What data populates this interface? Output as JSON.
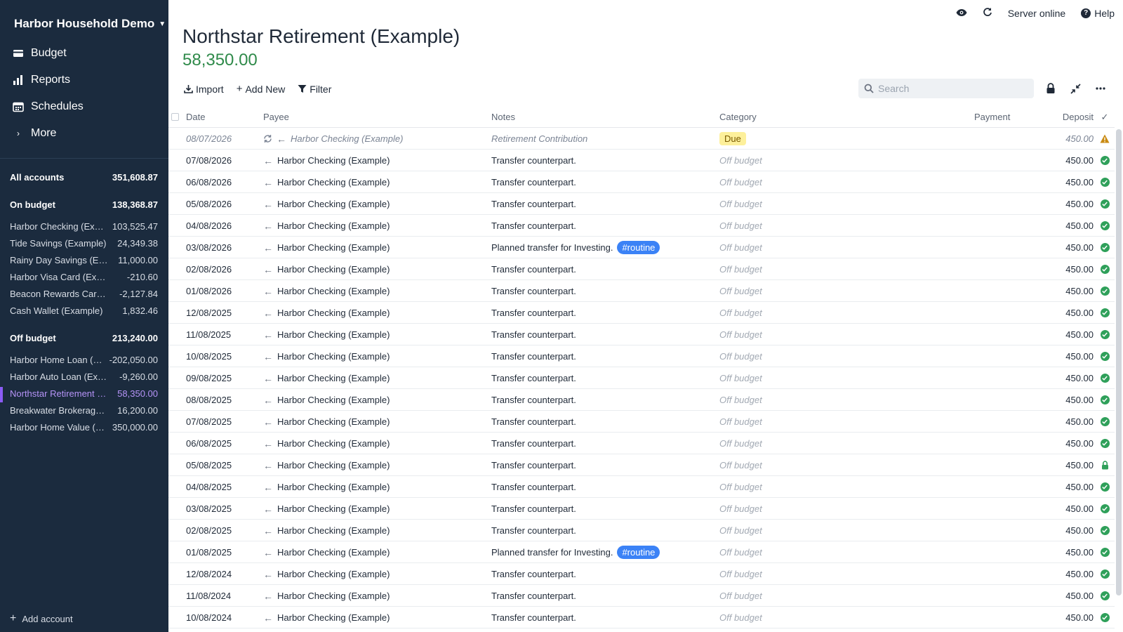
{
  "sidebar": {
    "budget_name": "Harbor Household Demo",
    "nav": [
      {
        "label": "Budget",
        "icon": "budget-icon"
      },
      {
        "label": "Reports",
        "icon": "reports-icon"
      },
      {
        "label": "Schedules",
        "icon": "calendar-icon"
      },
      {
        "label": "More",
        "icon": "chevron-right-icon"
      }
    ],
    "all_accounts": {
      "name": "All accounts",
      "balance": "351,608.87"
    },
    "on_budget": {
      "name": "On budget",
      "balance": "138,368.87"
    },
    "on_budget_accounts": [
      {
        "name": "Harbor Checking (Example)",
        "balance": "103,525.47"
      },
      {
        "name": "Tide Savings (Example)",
        "balance": "24,349.38"
      },
      {
        "name": "Rainy Day Savings (Example)",
        "balance": "11,000.00"
      },
      {
        "name": "Harbor Visa Card (Example)",
        "balance": "-210.60"
      },
      {
        "name": "Beacon Rewards Card (Example)",
        "balance": "-2,127.84"
      },
      {
        "name": "Cash Wallet (Example)",
        "balance": "1,832.46"
      }
    ],
    "off_budget": {
      "name": "Off budget",
      "balance": "213,240.00"
    },
    "off_budget_accounts": [
      {
        "name": "Harbor Home Loan (Example)",
        "balance": "-202,050.00"
      },
      {
        "name": "Harbor Auto Loan (Example)",
        "balance": "-9,260.00"
      },
      {
        "name": "Northstar Retirement (Example)",
        "balance": "58,350.00"
      },
      {
        "name": "Breakwater Brokerage (Example)",
        "balance": "16,200.00"
      },
      {
        "name": "Harbor Home Value (Example)",
        "balance": "350,000.00"
      }
    ],
    "add_account": "Add account"
  },
  "topbar": {
    "server_status": "Server online",
    "help": "Help"
  },
  "account": {
    "title": "Northstar Retirement (Example)",
    "balance": "58,350.00"
  },
  "toolbar": {
    "import": "Import",
    "add_new": "Add New",
    "filter": "Filter",
    "search_placeholder": "Search"
  },
  "table": {
    "headers": {
      "date": "Date",
      "payee": "Payee",
      "notes": "Notes",
      "category": "Category",
      "payment": "Payment",
      "deposit": "Deposit",
      "cleared": "✓"
    },
    "rows": [
      {
        "date": "08/07/2026",
        "payee": "Harbor Checking (Example)",
        "notes": "Retirement Contribution",
        "tag": "",
        "category": "Due",
        "deposit": "450.00",
        "status": "warning",
        "scheduled": true
      },
      {
        "date": "07/08/2026",
        "payee": "Harbor Checking (Example)",
        "notes": "Transfer counterpart.",
        "tag": "",
        "category": "Off budget",
        "deposit": "450.00",
        "status": "cleared"
      },
      {
        "date": "06/08/2026",
        "payee": "Harbor Checking (Example)",
        "notes": "Transfer counterpart.",
        "tag": "",
        "category": "Off budget",
        "deposit": "450.00",
        "status": "cleared"
      },
      {
        "date": "05/08/2026",
        "payee": "Harbor Checking (Example)",
        "notes": "Transfer counterpart.",
        "tag": "",
        "category": "Off budget",
        "deposit": "450.00",
        "status": "cleared"
      },
      {
        "date": "04/08/2026",
        "payee": "Harbor Checking (Example)",
        "notes": "Transfer counterpart.",
        "tag": "",
        "category": "Off budget",
        "deposit": "450.00",
        "status": "cleared"
      },
      {
        "date": "03/08/2026",
        "payee": "Harbor Checking (Example)",
        "notes": "Planned transfer for Investing.",
        "tag": "#routine",
        "category": "Off budget",
        "deposit": "450.00",
        "status": "cleared"
      },
      {
        "date": "02/08/2026",
        "payee": "Harbor Checking (Example)",
        "notes": "Transfer counterpart.",
        "tag": "",
        "category": "Off budget",
        "deposit": "450.00",
        "status": "cleared"
      },
      {
        "date": "01/08/2026",
        "payee": "Harbor Checking (Example)",
        "notes": "Transfer counterpart.",
        "tag": "",
        "category": "Off budget",
        "deposit": "450.00",
        "status": "cleared"
      },
      {
        "date": "12/08/2025",
        "payee": "Harbor Checking (Example)",
        "notes": "Transfer counterpart.",
        "tag": "",
        "category": "Off budget",
        "deposit": "450.00",
        "status": "cleared"
      },
      {
        "date": "11/08/2025",
        "payee": "Harbor Checking (Example)",
        "notes": "Transfer counterpart.",
        "tag": "",
        "category": "Off budget",
        "deposit": "450.00",
        "status": "cleared"
      },
      {
        "date": "10/08/2025",
        "payee": "Harbor Checking (Example)",
        "notes": "Transfer counterpart.",
        "tag": "",
        "category": "Off budget",
        "deposit": "450.00",
        "status": "cleared"
      },
      {
        "date": "09/08/2025",
        "payee": "Harbor Checking (Example)",
        "notes": "Transfer counterpart.",
        "tag": "",
        "category": "Off budget",
        "deposit": "450.00",
        "status": "cleared"
      },
      {
        "date": "08/08/2025",
        "payee": "Harbor Checking (Example)",
        "notes": "Transfer counterpart.",
        "tag": "",
        "category": "Off budget",
        "deposit": "450.00",
        "status": "cleared"
      },
      {
        "date": "07/08/2025",
        "payee": "Harbor Checking (Example)",
        "notes": "Transfer counterpart.",
        "tag": "",
        "category": "Off budget",
        "deposit": "450.00",
        "status": "cleared"
      },
      {
        "date": "06/08/2025",
        "payee": "Harbor Checking (Example)",
        "notes": "Transfer counterpart.",
        "tag": "",
        "category": "Off budget",
        "deposit": "450.00",
        "status": "cleared"
      },
      {
        "date": "05/08/2025",
        "payee": "Harbor Checking (Example)",
        "notes": "Transfer counterpart.",
        "tag": "",
        "category": "Off budget",
        "deposit": "450.00",
        "status": "locked"
      },
      {
        "date": "04/08/2025",
        "payee": "Harbor Checking (Example)",
        "notes": "Transfer counterpart.",
        "tag": "",
        "category": "Off budget",
        "deposit": "450.00",
        "status": "cleared"
      },
      {
        "date": "03/08/2025",
        "payee": "Harbor Checking (Example)",
        "notes": "Transfer counterpart.",
        "tag": "",
        "category": "Off budget",
        "deposit": "450.00",
        "status": "cleared"
      },
      {
        "date": "02/08/2025",
        "payee": "Harbor Checking (Example)",
        "notes": "Transfer counterpart.",
        "tag": "",
        "category": "Off budget",
        "deposit": "450.00",
        "status": "cleared"
      },
      {
        "date": "01/08/2025",
        "payee": "Harbor Checking (Example)",
        "notes": "Planned transfer for Investing.",
        "tag": "#routine",
        "category": "Off budget",
        "deposit": "450.00",
        "status": "cleared"
      },
      {
        "date": "12/08/2024",
        "payee": "Harbor Checking (Example)",
        "notes": "Transfer counterpart.",
        "tag": "",
        "category": "Off budget",
        "deposit": "450.00",
        "status": "cleared"
      },
      {
        "date": "11/08/2024",
        "payee": "Harbor Checking (Example)",
        "notes": "Transfer counterpart.",
        "tag": "",
        "category": "Off budget",
        "deposit": "450.00",
        "status": "cleared"
      },
      {
        "date": "10/08/2024",
        "payee": "Harbor Checking (Example)",
        "notes": "Transfer counterpart.",
        "tag": "",
        "category": "Off budget",
        "deposit": "450.00",
        "status": "cleared"
      }
    ]
  },
  "colors": {
    "sidebar_bg": "#1b2b3e",
    "balance_green": "#2f8a4a",
    "cleared_green": "#2fa05a",
    "selected_purple": "#b593f7",
    "tag_blue": "#3b82f6",
    "due_yellow": "#fdf09b"
  }
}
